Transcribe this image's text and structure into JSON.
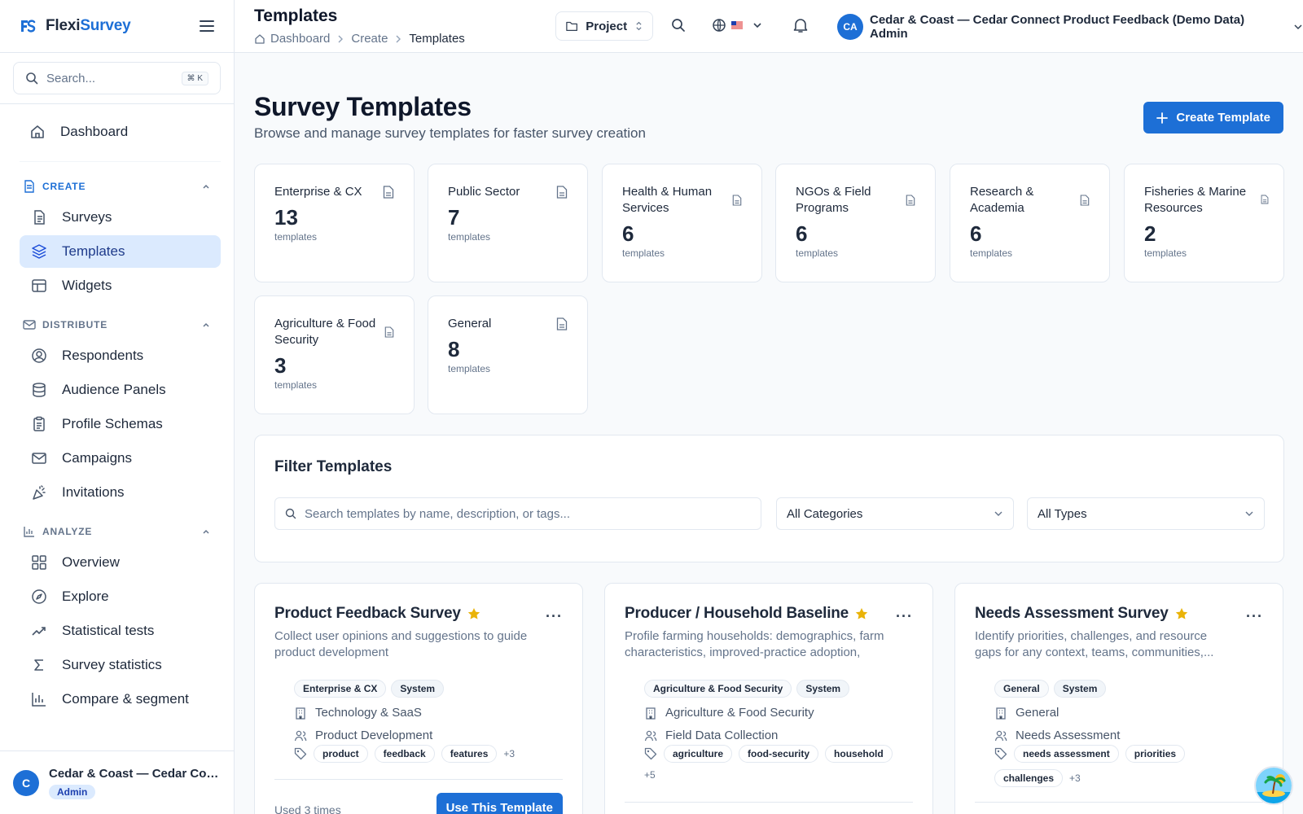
{
  "brand": {
    "prefix": "Flexi",
    "suffix": "Survey"
  },
  "sidebar": {
    "search_placeholder": "Search...",
    "search_shortcut": "⌘ K",
    "dashboard": "Dashboard",
    "sections": [
      {
        "title": "CREATE",
        "items": [
          "Surveys",
          "Templates",
          "Widgets"
        ]
      },
      {
        "title": "DISTRIBUTE",
        "items": [
          "Respondents",
          "Audience Panels",
          "Profile Schemas",
          "Campaigns",
          "Invitations"
        ]
      },
      {
        "title": "ANALYZE",
        "items": [
          "Overview",
          "Explore",
          "Statistical tests",
          "Survey statistics",
          "Compare & segment"
        ]
      }
    ],
    "footer": {
      "initial": "C",
      "name": "Cedar & Coast — Cedar Connect Product Feedback (Demo Data) Admin",
      "role": "Admin"
    }
  },
  "topbar": {
    "title": "Templates",
    "breadcrumb": [
      "Dashboard",
      "Create",
      "Templates"
    ],
    "project_label": "Project",
    "user_initials": "CA",
    "user_name": "Cedar & Coast — Cedar Connect Product Feedback (Demo Data) Admin"
  },
  "page": {
    "title": "Survey Templates",
    "subtitle": "Browse and manage survey templates for faster survey creation",
    "create_button": "Create Template"
  },
  "categories": [
    {
      "name": "Enterprise & CX",
      "count": "13",
      "label": "templates"
    },
    {
      "name": "Public Sector",
      "count": "7",
      "label": "templates"
    },
    {
      "name": "Health & Human Services",
      "count": "6",
      "label": "templates"
    },
    {
      "name": "NGOs & Field Programs",
      "count": "6",
      "label": "templates"
    },
    {
      "name": "Research & Academia",
      "count": "6",
      "label": "templates"
    },
    {
      "name": "Fisheries & Marine Resources",
      "count": "2",
      "label": "templates"
    },
    {
      "name": "Agriculture & Food Security",
      "count": "3",
      "label": "templates"
    },
    {
      "name": "General",
      "count": "8",
      "label": "templates"
    }
  ],
  "filter": {
    "title": "Filter Templates",
    "search_placeholder": "Search templates by name, description, or tags...",
    "category_value": "All Categories",
    "type_value": "All Types"
  },
  "templates": [
    {
      "name": "Product Feedback Survey",
      "description": "Collect user opinions and suggestions to guide product development",
      "category": "Enterprise & CX",
      "type": "System",
      "industry": "Technology & SaaS",
      "audience": "Product Development",
      "tags": [
        "product",
        "feedback",
        "features"
      ],
      "more_tags": "+3",
      "used": "Used 3 times",
      "button": "Use This Template"
    },
    {
      "name": "Producer / Household Baseline",
      "description": "Profile farming households: demographics, farm characteristics, improved-practice adoption, cro...",
      "category": "Agriculture & Food Security",
      "type": "System",
      "industry": "Agriculture & Food Security",
      "audience": "Field Data Collection",
      "tags": [
        "agriculture",
        "food-security",
        "household"
      ],
      "more_tags": "+5"
    },
    {
      "name": "Needs Assessment Survey",
      "description": "Identify priorities, challenges, and resource gaps for any context, teams, communities,...",
      "category": "General",
      "type": "System",
      "industry": "General",
      "audience": "Needs Assessment",
      "tags": [
        "needs assessment",
        "priorities",
        "challenges"
      ],
      "more_tags": "+3"
    }
  ]
}
